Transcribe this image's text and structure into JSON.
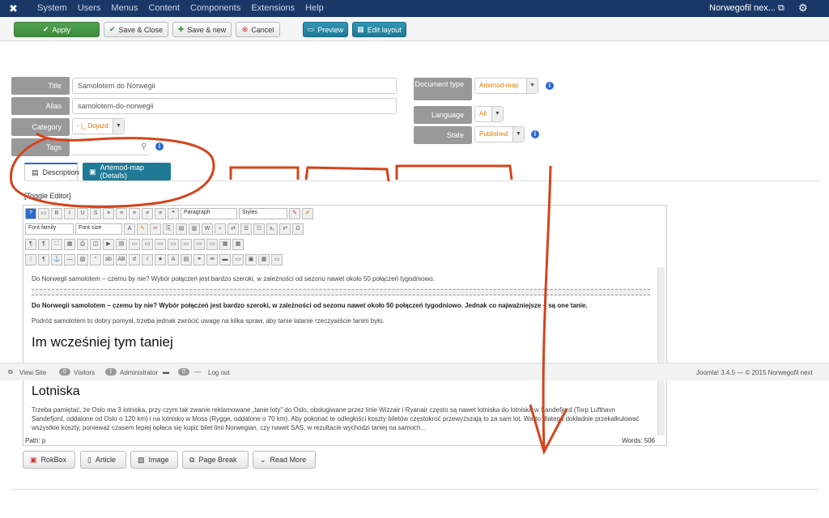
{
  "topbar": {
    "logo": "✖",
    "menu": [
      "System",
      "Users",
      "Menus",
      "Content",
      "Components",
      "Extensions",
      "Help"
    ],
    "site": "Norwegofil nex... ⧉",
    "gear": "⚙"
  },
  "toolbar": {
    "apply": "Apply",
    "save_close": "Save & Close",
    "save_new": "Save & new",
    "cancel": "Cancel",
    "preview": "Preview",
    "edit_layout": "Edit layout"
  },
  "form": {
    "title_label": "Title",
    "title_value": "Samolotem do Norwegii",
    "alias_label": "Alias",
    "alias_value": "samolotem-do-norwegii",
    "category_label": "Category",
    "category_value": "- |_ Dojazd",
    "tags_label": "Tags",
    "doctype_label": "Document type",
    "doctype_value": "Artemod-map",
    "language_label": "Language",
    "language_value": "All",
    "state_label": "State",
    "state_value": "Published"
  },
  "tabs": {
    "description": "Description",
    "artemod": "Artemod-map (Details)"
  },
  "toggle_editor": "[Toggle Editor]",
  "editor": {
    "paragraph": "Paragraph",
    "styles": "Styles",
    "font_family": "Font family",
    "font_size": "Font size",
    "p1": "Do Norwegii samolotem – czemu by nie? Wybór połączeń jest  bardzo szeroki, w zależności od sezonu nawet około 50 połączeń tygodniowo.",
    "p2": "Do Norwegii samolotem – czemu by nie? Wybór połączeń jest  bardzo szeroki, w zależności od sezonu nawet około 50 połączeń tygodniowo. Jednak co najważniejsze – są one tanie.",
    "p3": "Podróż samolotem to dobry pomysł, trzeba jednak zwrócić uwagę na kilka spraw, aby tanie latanie rzeczywiście tanim było.",
    "h1": "Im wcześniej tym taniej",
    "h2": "Lotniska",
    "p4": "Trzeba pamiętać, że Oslo ma 3 lotniska, przy czym tak zwanie reklamowane „tanie loty” do Oslo, obsługiwane przez linie Wizzair i Ryanair często są nawet lotniska do lotniska w Sandefjord (Torp Lufthavn Sandefjord, oddalone od Oslo o 120 km) i na lotnisko w Moss (Rygge, oddalone o 70 km). Aby pokonać te odległości koszty biletów częstokroć przewyższają to za sam lot. Warto dlatego dokładnie przekalkulować wszystkie koszty, ponieważ czasem lepiej opłaca się kupić bilet linii Norwegian, czy nawet SAS, w rezultacie wychodzi taniej na samoch...",
    "path": "Path: p",
    "words": "Words: 506"
  },
  "status": {
    "view_site": "View Site",
    "visitors_count": "0",
    "visitors": "Visitors",
    "admin_count": "1",
    "admin": "Administrator",
    "logout_count": "0",
    "logout": "Log out",
    "version": "Joomla! 3.4.5 — © 2015 Norwegofil next"
  },
  "buttons": {
    "rokbox": "RokBox",
    "article": "Article",
    "image": "Image",
    "page_break": "Page Break",
    "read_more": "Read More"
  }
}
